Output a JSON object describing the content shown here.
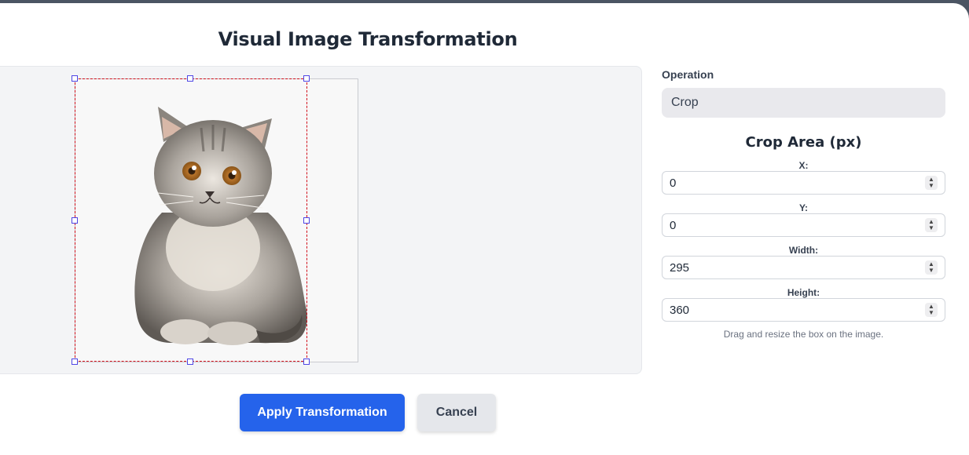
{
  "dialog": {
    "title": "Visual Image Transformation"
  },
  "operation": {
    "label": "Operation",
    "selected": "Crop"
  },
  "crop": {
    "section_title": "Crop Area (px)",
    "fields": [
      {
        "label": "X:",
        "value": "0"
      },
      {
        "label": "Y:",
        "value": "0"
      },
      {
        "label": "Width:",
        "value": "295"
      },
      {
        "label": "Height:",
        "value": "360"
      }
    ],
    "hint": "Drag and resize the box on the image."
  },
  "actions": {
    "apply_label": "Apply Transformation",
    "cancel_label": "Cancel"
  },
  "colors": {
    "primary": "#2563eb",
    "crop_border": "#d10f1a",
    "handle_border": "#4f46e5"
  },
  "image": {
    "subject": "cat-photo"
  }
}
